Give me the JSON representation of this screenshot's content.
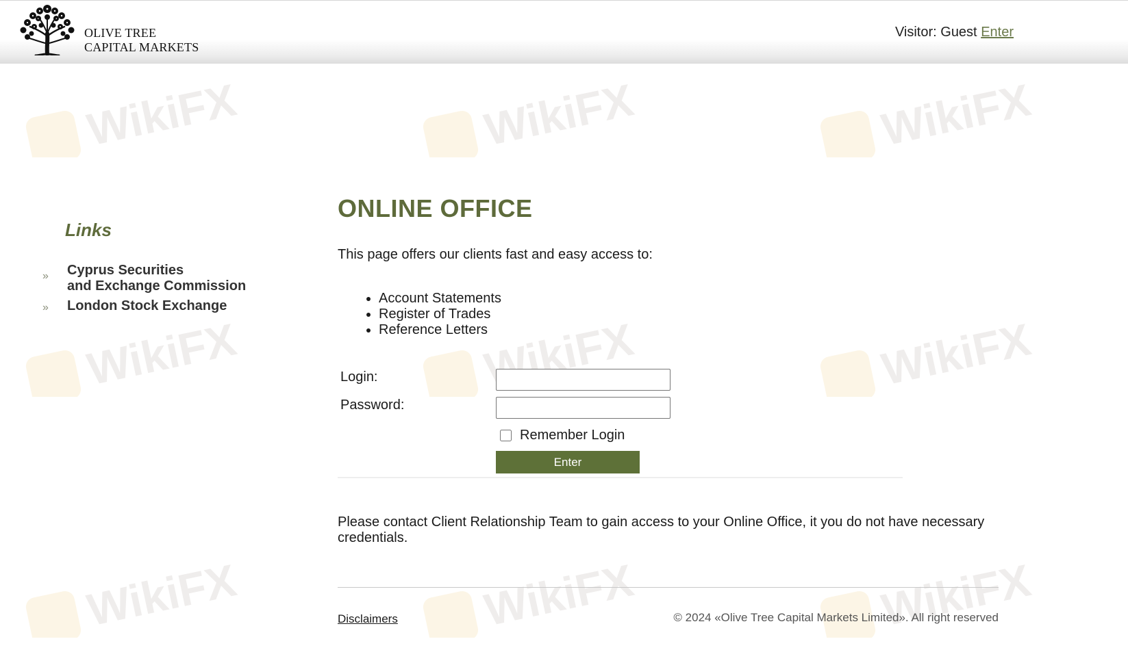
{
  "header": {
    "logo_line1": "OLIVE TREE",
    "logo_line2": "CAPITAL MARKETS",
    "visitor_prefix": "Visitor: Guest",
    "visitor_link": "Enter"
  },
  "watermark": {
    "text": "WikiFX"
  },
  "sidebar": {
    "title": "Links",
    "items": [
      {
        "arrow": "»",
        "line1": "Cyprus Securities",
        "line2": "and Exchange Commission"
      },
      {
        "arrow": "»",
        "line1": "London Stock Exchange"
      }
    ]
  },
  "main": {
    "title": "ONLINE OFFICE",
    "intro": "This page offers our clients fast and easy access to:",
    "bullets": [
      "Account Statements",
      "Register of Trades",
      "Reference Letters"
    ],
    "form": {
      "login_label": "Login:",
      "login_value": "",
      "password_label": "Password:",
      "password_value": "",
      "remember_label": "Remember Login",
      "remember_checked": false,
      "submit_label": "Enter"
    },
    "contact_text": "Please contact Client Relationship Team to gain access to your Online Office, it you do not have necessary credentials."
  },
  "footer": {
    "disclaimers": "Disclaimers",
    "copyright": "© 2024 «Olive Tree Capital Markets Limited». All right reserved"
  },
  "colors": {
    "accent": "#5e6b3b",
    "button": "#5e7138",
    "link": "#6b7a4b",
    "watermark_text": "#e3dfdd",
    "watermark_badge": "#fbeed2"
  }
}
